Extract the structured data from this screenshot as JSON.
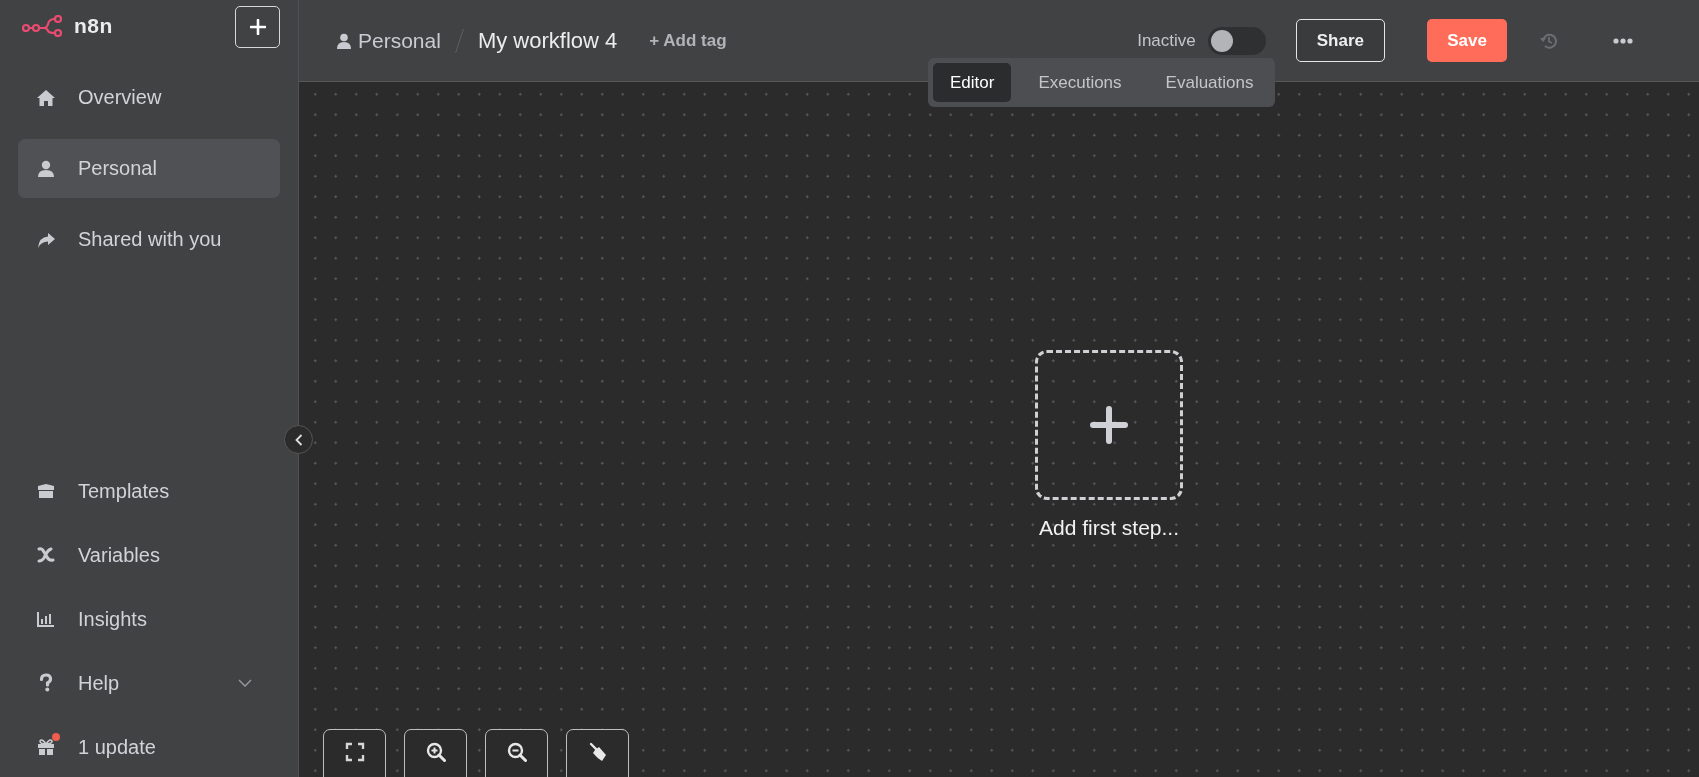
{
  "sidebar": {
    "logo": "n8n",
    "items": [
      {
        "label": "Overview",
        "selected": false
      },
      {
        "label": "Personal",
        "selected": true
      },
      {
        "label": "Shared with you",
        "selected": false
      }
    ],
    "bottom_items": [
      {
        "label": "Templates",
        "kind": "link"
      },
      {
        "label": "Variables",
        "kind": "link"
      },
      {
        "label": "Insights",
        "kind": "link"
      },
      {
        "label": "Help",
        "kind": "submenu"
      },
      {
        "label": "1 update",
        "kind": "update"
      }
    ]
  },
  "header": {
    "breadcrumb": "Personal",
    "workflow_name": "My workflow 4",
    "add_tag": "+ Add tag",
    "toggle": {
      "label": "Inactive",
      "on": false
    },
    "buttons": [
      {
        "label": "Share",
        "kind": "outline"
      },
      {
        "label": "Save",
        "kind": "primary"
      }
    ]
  },
  "tabs": [
    {
      "label": "Editor",
      "selected": true
    },
    {
      "label": "Executions",
      "selected": false
    },
    {
      "label": "Evaluations",
      "selected": false
    }
  ],
  "canvas": {
    "add_step_label": "Add first step..."
  }
}
